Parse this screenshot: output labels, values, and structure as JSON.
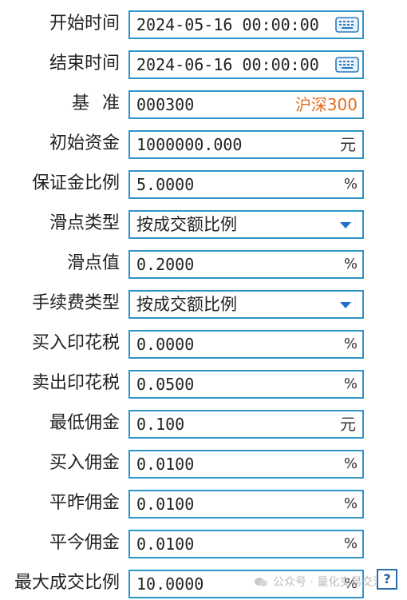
{
  "form": {
    "start_time": {
      "label": "开始时间",
      "value": "2024-05-16 00:00:00"
    },
    "end_time": {
      "label": "结束时间",
      "value": "2024-06-16 00:00:00"
    },
    "benchmark": {
      "label": "基准",
      "value": "000300",
      "name": "沪深300"
    },
    "initial_capital": {
      "label": "初始资金",
      "value": "1000000.000",
      "unit": "元"
    },
    "margin_ratio": {
      "label": "保证金比例",
      "value": "5.0000",
      "unit": "%"
    },
    "slippage_type": {
      "label": "滑点类型",
      "value": "按成交额比例"
    },
    "slippage_value": {
      "label": "滑点值",
      "value": "0.2000",
      "unit": "%"
    },
    "fee_type": {
      "label": "手续费类型",
      "value": "按成交额比例"
    },
    "buy_stamp_tax": {
      "label": "买入印花税",
      "value": "0.0000",
      "unit": "%"
    },
    "sell_stamp_tax": {
      "label": "卖出印花税",
      "value": "0.0500",
      "unit": "%"
    },
    "min_commission": {
      "label": "最低佣金",
      "value": "0.100",
      "unit": "元"
    },
    "buy_commission": {
      "label": "买入佣金",
      "value": "0.0100",
      "unit": "%"
    },
    "close_yesterday_commission": {
      "label": "平昨佣金",
      "value": "0.0100",
      "unit": "%"
    },
    "close_today_commission": {
      "label": "平今佣金",
      "value": "0.0100",
      "unit": "%"
    },
    "max_volume_ratio": {
      "label": "最大成交比例",
      "value": "10.0000",
      "unit": "%"
    }
  },
  "help_button": {
    "label": "?"
  },
  "watermark": {
    "text": "公众号 · 量化交易交流"
  },
  "colors": {
    "border": "#2f95c8",
    "benchmark_name": "#e36c1e",
    "dropdown_arrow": "#1e73c8"
  }
}
